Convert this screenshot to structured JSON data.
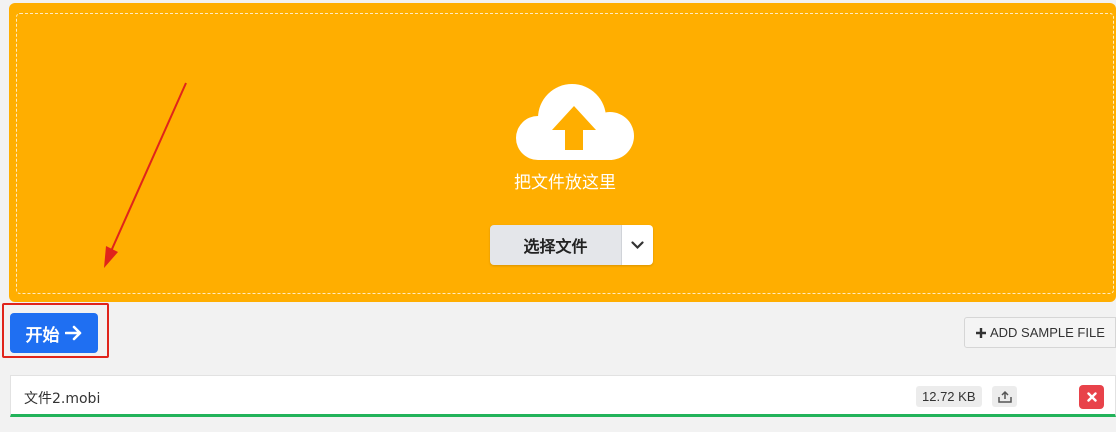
{
  "dropzone": {
    "prompt": "把文件放这里",
    "choose_label": "选择文件",
    "cloud_icon": "cloud-upload-icon",
    "background_color": "#ffae00"
  },
  "actions": {
    "start_label": "开始",
    "add_sample_label": "ADD SAMPLE FILE"
  },
  "files": [
    {
      "name": "文件2.mobi",
      "size": "12.72 KB"
    }
  ],
  "colors": {
    "primary": "#1f6ff2",
    "success": "#22b35a",
    "danger": "#e8424a",
    "annotation": "#e0241b"
  }
}
